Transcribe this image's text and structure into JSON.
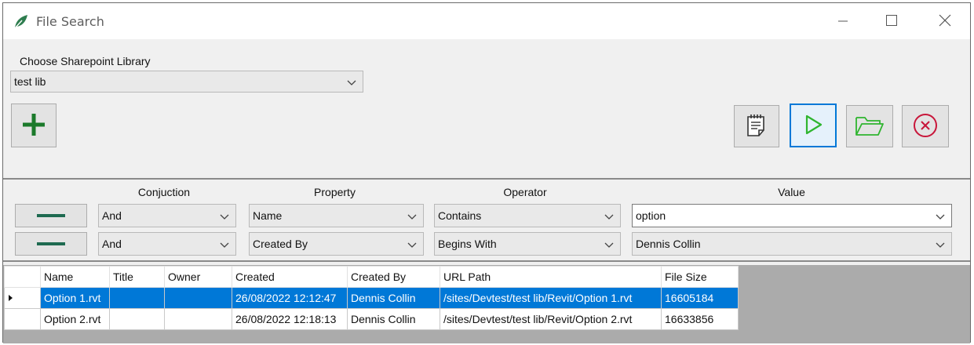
{
  "window": {
    "title": "File Search",
    "icon": "leaf-icon",
    "controls": [
      "minimize-icon",
      "maximize-icon",
      "close-icon"
    ]
  },
  "library": {
    "label": "Choose Sharepoint Library",
    "selected": "test lib"
  },
  "toolbar": {
    "add_icon": "plus-icon",
    "notes_icon": "notepad-icon",
    "run_icon": "play-icon",
    "open_icon": "folder-icon",
    "cancel_icon": "cancel-circle-icon"
  },
  "filters": {
    "headers": {
      "conjunction": "Conjuction",
      "property": "Property",
      "operator": "Operator",
      "value": "Value"
    },
    "rows": [
      {
        "conjunction": "And",
        "property": "Name",
        "operator": "Contains",
        "value": "option"
      },
      {
        "conjunction": "And",
        "property": "Created By",
        "operator": "Begins With",
        "value": "Dennis Collin"
      }
    ]
  },
  "results": {
    "columns": [
      "Name",
      "Title",
      "Owner",
      "Created",
      "Created By",
      "URL Path",
      "File Size"
    ],
    "rows": [
      [
        "Option 1.rvt",
        "",
        "",
        "26/08/2022 12:12:47",
        "Dennis Collin",
        "/sites/Devtest/test lib/Revit/Option 1.rvt",
        "16605184"
      ],
      [
        "Option 2.rvt",
        "",
        "",
        "26/08/2022 12:18:13",
        "Dennis Collin",
        "/sites/Devtest/test lib/Revit/Option 2.rvt",
        "16633856"
      ]
    ],
    "selected_row": 0
  },
  "colors": {
    "accent_green": "#1b7a2b",
    "selection_blue": "#0078d7",
    "cancel_red": "#c8163a",
    "play_green": "#2fb52f",
    "folder_green": "#2fb52f"
  }
}
